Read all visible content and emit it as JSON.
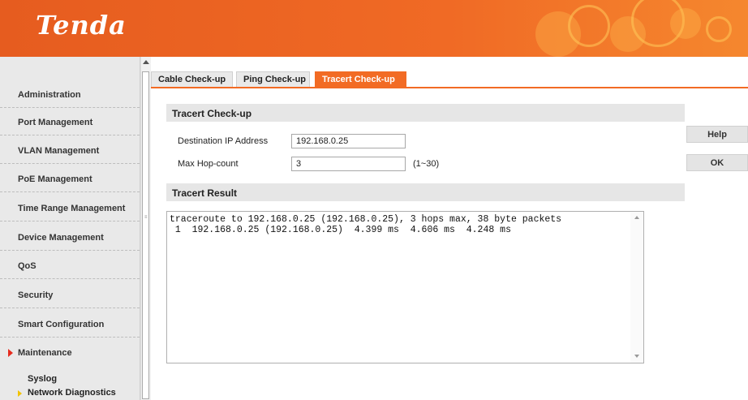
{
  "header": {
    "logo_text": "Tenda",
    "brand_color": "#f26b24"
  },
  "sidebar": {
    "items": [
      {
        "label": "Administration"
      },
      {
        "label": "Port Management"
      },
      {
        "label": "VLAN Management"
      },
      {
        "label": "PoE Management"
      },
      {
        "label": "Time Range Management"
      },
      {
        "label": "Device Management"
      },
      {
        "label": "QoS"
      },
      {
        "label": "Security"
      },
      {
        "label": "Smart Configuration"
      },
      {
        "label": "Maintenance",
        "expanded": true
      }
    ],
    "subitems": [
      {
        "label": "Syslog",
        "selected": false
      },
      {
        "label": "Network Diagnostics",
        "selected": true
      }
    ]
  },
  "tabs": [
    {
      "label": "Cable Check-up",
      "active": false
    },
    {
      "label": "Ping Check-up",
      "active": false
    },
    {
      "label": "Tracert Check-up",
      "active": true
    }
  ],
  "form": {
    "section_title": "Tracert Check-up",
    "dest_label": "Destination IP Address",
    "dest_value": "192.168.0.25",
    "hop_label": "Max Hop-count",
    "hop_value": "3",
    "hop_hint": "(1~30)"
  },
  "result": {
    "section_title": "Tracert Result",
    "text": "traceroute to 192.168.0.25 (192.168.0.25), 3 hops max, 38 byte packets\n 1  192.168.0.25 (192.168.0.25)  4.399 ms  4.606 ms  4.248 ms"
  },
  "buttons": {
    "help": "Help",
    "ok": "OK"
  }
}
